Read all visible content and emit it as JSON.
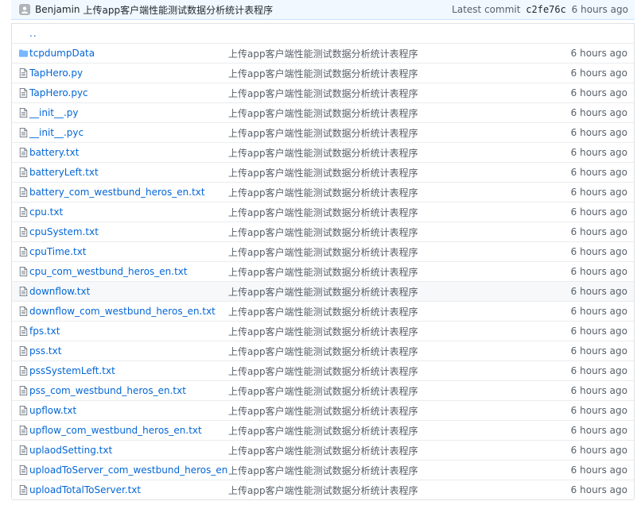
{
  "commit": {
    "author": "Benjamin",
    "message": "上传app客户端性能测试数据分析统计表程序",
    "latest_label": "Latest commit",
    "sha": "c2fe76c",
    "age": "6 hours ago"
  },
  "parent_link": "..",
  "files": [
    {
      "name": "tcpdumpData",
      "type": "folder",
      "message": "上传app客户端性能测试数据分析统计表程序",
      "age": "6 hours ago"
    },
    {
      "name": "TapHero.py",
      "type": "file",
      "message": "上传app客户端性能测试数据分析统计表程序",
      "age": "6 hours ago"
    },
    {
      "name": "TapHero.pyc",
      "type": "file",
      "message": "上传app客户端性能测试数据分析统计表程序",
      "age": "6 hours ago"
    },
    {
      "name": "__init__.py",
      "type": "file",
      "message": "上传app客户端性能测试数据分析统计表程序",
      "age": "6 hours ago"
    },
    {
      "name": "__init__.pyc",
      "type": "file",
      "message": "上传app客户端性能测试数据分析统计表程序",
      "age": "6 hours ago"
    },
    {
      "name": "battery.txt",
      "type": "file",
      "message": "上传app客户端性能测试数据分析统计表程序",
      "age": "6 hours ago"
    },
    {
      "name": "batteryLeft.txt",
      "type": "file",
      "message": "上传app客户端性能测试数据分析统计表程序",
      "age": "6 hours ago"
    },
    {
      "name": "battery_com_westbund_heros_en.txt",
      "type": "file",
      "message": "上传app客户端性能测试数据分析统计表程序",
      "age": "6 hours ago"
    },
    {
      "name": "cpu.txt",
      "type": "file",
      "message": "上传app客户端性能测试数据分析统计表程序",
      "age": "6 hours ago"
    },
    {
      "name": "cpuSystem.txt",
      "type": "file",
      "message": "上传app客户端性能测试数据分析统计表程序",
      "age": "6 hours ago"
    },
    {
      "name": "cpuTime.txt",
      "type": "file",
      "message": "上传app客户端性能测试数据分析统计表程序",
      "age": "6 hours ago"
    },
    {
      "name": "cpu_com_westbund_heros_en.txt",
      "type": "file",
      "message": "上传app客户端性能测试数据分析统计表程序",
      "age": "6 hours ago"
    },
    {
      "name": "downflow.txt",
      "type": "file",
      "message": "上传app客户端性能测试数据分析统计表程序",
      "age": "6 hours ago",
      "highlight": true
    },
    {
      "name": "downflow_com_westbund_heros_en.txt",
      "type": "file",
      "message": "上传app客户端性能测试数据分析统计表程序",
      "age": "6 hours ago"
    },
    {
      "name": "fps.txt",
      "type": "file",
      "message": "上传app客户端性能测试数据分析统计表程序",
      "age": "6 hours ago"
    },
    {
      "name": "pss.txt",
      "type": "file",
      "message": "上传app客户端性能测试数据分析统计表程序",
      "age": "6 hours ago"
    },
    {
      "name": "pssSystemLeft.txt",
      "type": "file",
      "message": "上传app客户端性能测试数据分析统计表程序",
      "age": "6 hours ago"
    },
    {
      "name": "pss_com_westbund_heros_en.txt",
      "type": "file",
      "message": "上传app客户端性能测试数据分析统计表程序",
      "age": "6 hours ago"
    },
    {
      "name": "upflow.txt",
      "type": "file",
      "message": "上传app客户端性能测试数据分析统计表程序",
      "age": "6 hours ago"
    },
    {
      "name": "upflow_com_westbund_heros_en.txt",
      "type": "file",
      "message": "上传app客户端性能测试数据分析统计表程序",
      "age": "6 hours ago"
    },
    {
      "name": "uplaodSetting.txt",
      "type": "file",
      "message": "上传app客户端性能测试数据分析统计表程序",
      "age": "6 hours ago"
    },
    {
      "name": "uploadToServer_com_westbund_heros_en.txt",
      "type": "file",
      "message": "上传app客户端性能测试数据分析统计表程序",
      "age": "6 hours ago"
    },
    {
      "name": "uploadTotalToServer.txt",
      "type": "file",
      "message": "上传app客户端性能测试数据分析统计表程序",
      "age": "6 hours ago"
    }
  ]
}
